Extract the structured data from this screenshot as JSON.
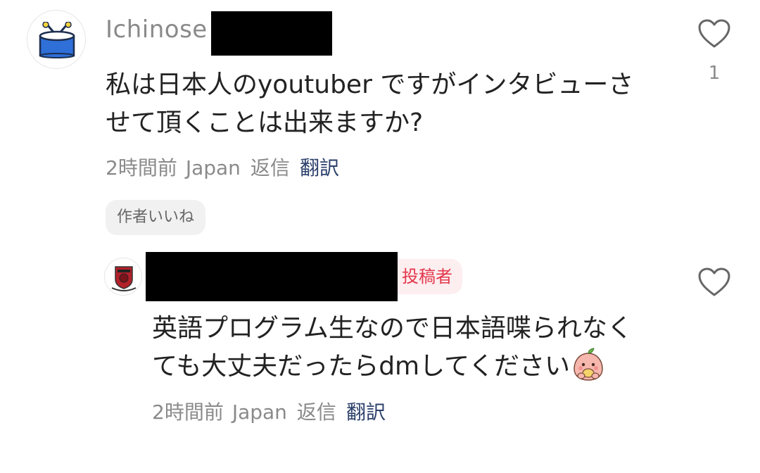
{
  "comment": {
    "username": "Ichinose",
    "text_line1": "私は日本人のyoutuber ですがインタビューさ",
    "text_line2": "せて頂くことは出来ますか?",
    "time": "2時間前",
    "location": "Japan",
    "reply_label": "返信",
    "translate_label": "翻訳",
    "author_like_label": "作者いいね",
    "like_count": "1",
    "avatar_icon": "drum-icon"
  },
  "reply": {
    "op_badge": "投稿者",
    "text_line1": "英語プログラム生なので日本語喋られなく",
    "text_line2": "ても大丈夫だったらdmしてください",
    "emoji_icon": "peach-character-emoji",
    "time": "2時間前",
    "location": "Japan",
    "reply_label": "返信",
    "translate_label": "翻訳",
    "avatar_icon": "crest-logo-icon"
  },
  "colors": {
    "meta_gray": "#8a8a8a",
    "translate_blue": "#2b3f6b",
    "op_badge_text": "#e3384b",
    "op_badge_bg": "#fdeef0"
  }
}
